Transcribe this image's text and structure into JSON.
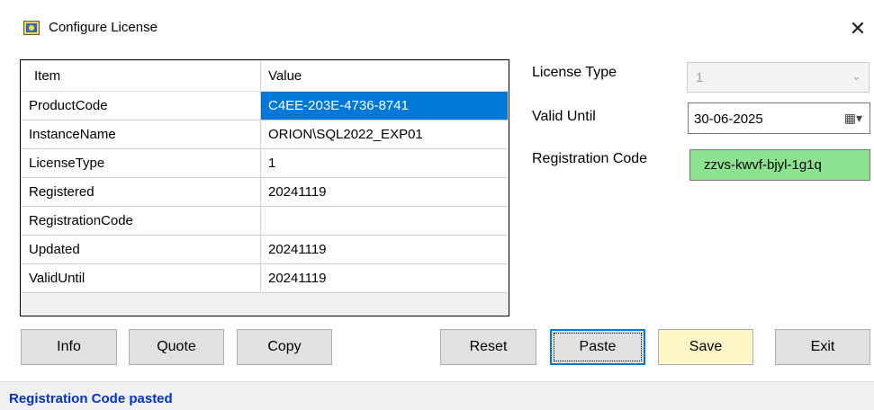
{
  "window": {
    "title": "Configure License",
    "close_glyph": "✕"
  },
  "grid": {
    "headers": {
      "item": "Item",
      "value": "Value"
    },
    "rows": [
      {
        "item": "ProductCode",
        "value": "C4EE-203E-4736-8741"
      },
      {
        "item": "InstanceName",
        "value": "ORION\\SQL2022_EXP01"
      },
      {
        "item": "LicenseType",
        "value": "1"
      },
      {
        "item": "Registered",
        "value": "20241119"
      },
      {
        "item": "RegistrationCode",
        "value": ""
      },
      {
        "item": "Updated",
        "value": "20241119"
      },
      {
        "item": "ValidUntil",
        "value": "20241119"
      }
    ]
  },
  "form": {
    "license_type_label": "License Type",
    "license_type_value": "1",
    "valid_until_label": "Valid Until",
    "valid_until_value": "30-06-2025",
    "registration_code_label": "Registration Code",
    "registration_code_value": "zzvs-kwvf-bjyl-1g1q"
  },
  "buttons": {
    "info": "Info",
    "quote": "Quote",
    "copy": "Copy",
    "reset": "Reset",
    "paste": "Paste",
    "save": "Save",
    "exit": "Exit"
  },
  "status": {
    "message": "Registration Code pasted"
  },
  "colors": {
    "selection": "#0078d7",
    "reg_code_bg": "#8be38f",
    "save_bg": "#fff6c8",
    "status_text": "#0033cc"
  },
  "icons": {
    "app": "license-app-icon",
    "close": "close-icon",
    "dropdown": "chevron-down-icon",
    "calendar": "calendar-icon"
  }
}
